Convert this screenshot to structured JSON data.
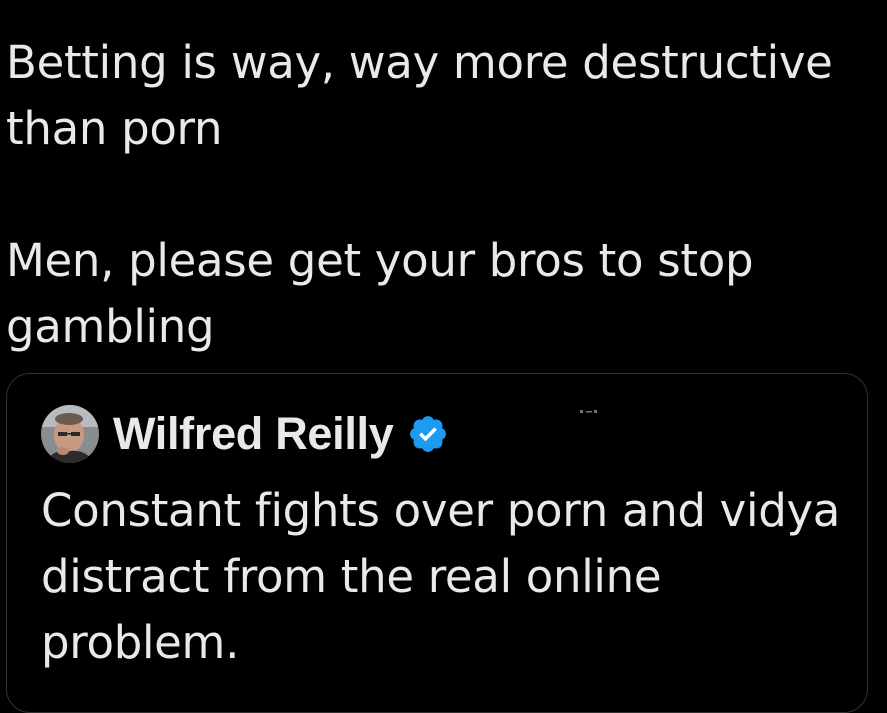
{
  "tweet": {
    "line1": "Betting is way, way more destructive than porn",
    "line2": "Men, please get your bros to stop gambling"
  },
  "quoted_tweet": {
    "author_name": "Wilfred Reilly",
    "verified": true,
    "text": "Constant fights over porn and vidya distract from the real online problem."
  },
  "colors": {
    "background": "#000000",
    "text": "#e7e9ea",
    "border": "#2f3336",
    "verified_badge": "#1d9bf0"
  },
  "icons": {
    "verified": "verified-badge-icon",
    "avatar": "profile-photo"
  }
}
